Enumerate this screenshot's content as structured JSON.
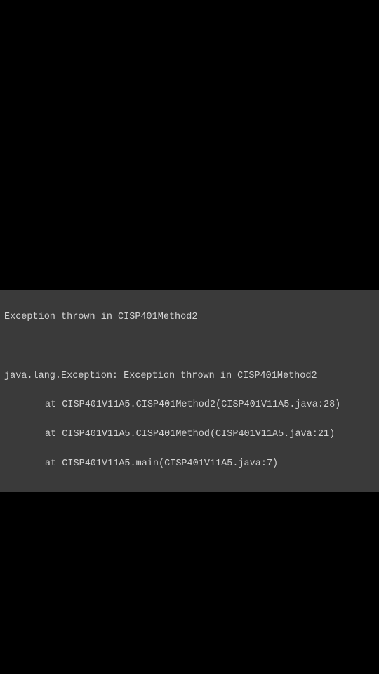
{
  "console": {
    "line1": "Exception thrown in CISP401Method2",
    "line2": "",
    "line3": "java.lang.Exception: Exception thrown in CISP401Method2",
    "line4": "at CISP401V11A5.CISP401Method2(CISP401V11A5.java:28)",
    "line5": "at CISP401V11A5.CISP401Method(CISP401V11A5.java:21)",
    "line6": "at CISP401V11A5.main(CISP401V11A5.java:7)"
  }
}
